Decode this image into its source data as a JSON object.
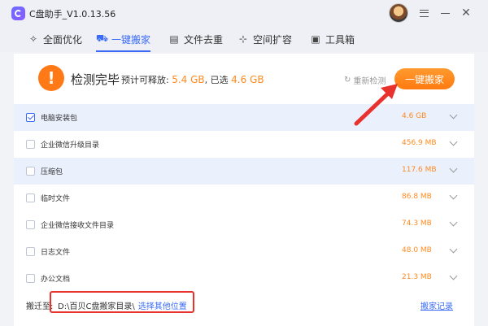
{
  "window": {
    "title": "C盘助手_V1.0.13.56"
  },
  "nav": {
    "tabs": [
      {
        "label": "全面优化",
        "icon": "sparkle-icon"
      },
      {
        "label": "一键搬家",
        "icon": "truck-icon"
      },
      {
        "label": "文件去重",
        "icon": "file-icon"
      },
      {
        "label": "空间扩容",
        "icon": "expand-icon"
      },
      {
        "label": "工具箱",
        "icon": "toolbox-icon"
      }
    ]
  },
  "status": {
    "title": "检测完毕",
    "info_prefix": "预计可释放:",
    "releasable": "5.4 GB",
    "info_mid": ", 已选",
    "selected": "4.6 GB",
    "rescan": "重新检测",
    "move_button": "一键搬家"
  },
  "items": [
    {
      "name": "电脑安装包",
      "size": "4.6 GB",
      "checked": true
    },
    {
      "name": "企业微信升级目录",
      "size": "456.9 MB",
      "checked": false
    },
    {
      "name": "压缩包",
      "size": "117.6 MB",
      "checked": false
    },
    {
      "name": "临时文件",
      "size": "86.8 MB",
      "checked": false
    },
    {
      "name": "企业微信接收文件目录",
      "size": "74.3 MB",
      "checked": false
    },
    {
      "name": "日志文件",
      "size": "48.0 MB",
      "checked": false
    },
    {
      "name": "办公文档",
      "size": "21.3 MB",
      "checked": false
    }
  ],
  "footer": {
    "label": "搬迁至:",
    "path": "D:\\百贝C盘搬家目录\\",
    "choose_link": "选择其他位置",
    "history_link": "搬家记录"
  },
  "colors": {
    "accent_blue": "#3b6bf6",
    "accent_orange": "#ff8a1e",
    "annotation_red": "#e8322e"
  }
}
